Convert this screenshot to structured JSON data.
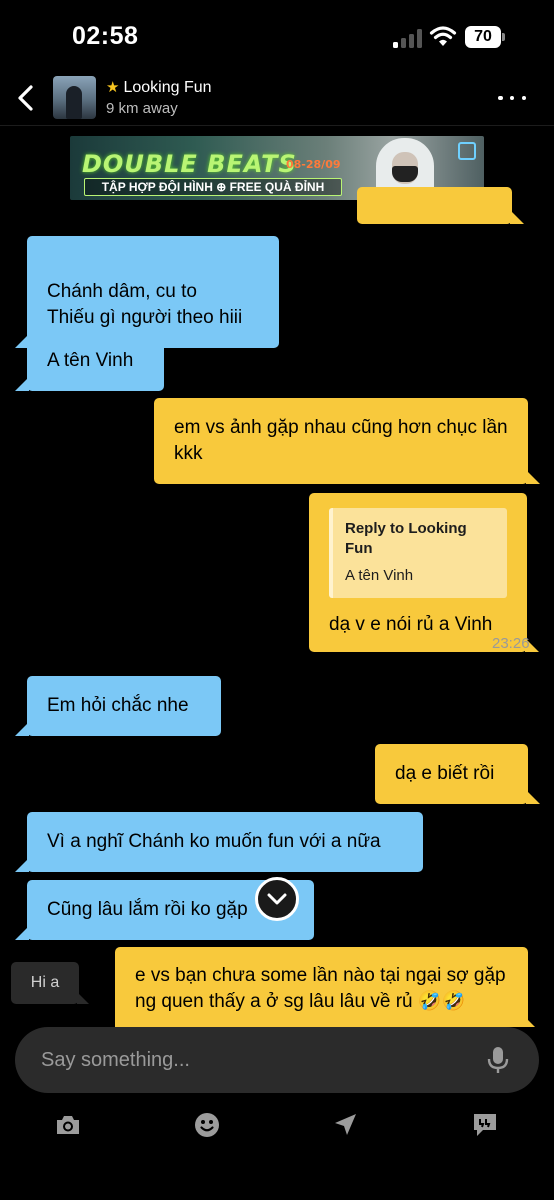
{
  "status_bar": {
    "time": "02:58",
    "battery": "70"
  },
  "header": {
    "contact_name": "Looking Fun",
    "distance": "9 km away",
    "favorite_icon": "star-icon",
    "colors": {
      "star": "#f7c520"
    }
  },
  "ad": {
    "title": "DOUBLE BEATS",
    "date": "08-28/09",
    "subtitle": "TẬP HỢP ĐỘI HÌNH ⊕ FREE QUÀ ĐỈNH"
  },
  "messages": [
    {
      "side": "in",
      "text": "Chánh dâm, cu to\nThiếu gì người theo hiii"
    },
    {
      "side": "in",
      "text": "A tên Vinh"
    },
    {
      "side": "out",
      "text": "em vs ảnh gặp nhau cũng hơn chục lần kkk"
    },
    {
      "side": "out",
      "reply_title": "Reply to Looking Fun",
      "reply_text": "A tên Vinh",
      "text": "dạ v e nói rủ a Vinh"
    },
    {
      "side": "in",
      "text": "Em hỏi chắc nhe"
    },
    {
      "side": "out",
      "text": "dạ e biết rồi"
    },
    {
      "side": "in",
      "text": "Vì a nghĩ Chánh ko muốn fun với a nữa"
    },
    {
      "side": "in",
      "text": "Cũng lâu lắm rồi ko gặp"
    },
    {
      "side": "out",
      "text": "e vs bạn chưa some lần nào tại ngại sợ gặp ng quen thấy a ở sg lâu lâu về rủ 🤣🤣"
    }
  ],
  "timestamp": "23:26",
  "typing_hint": "Hi a",
  "composer": {
    "placeholder": "Say something..."
  },
  "colors": {
    "incoming_bubble": "#7bc8f6",
    "outgoing_bubble": "#f8c93c",
    "background": "#000000"
  },
  "toolbar": [
    "camera-icon",
    "emoji-icon",
    "location-send-icon",
    "saved-phrases-icon"
  ]
}
